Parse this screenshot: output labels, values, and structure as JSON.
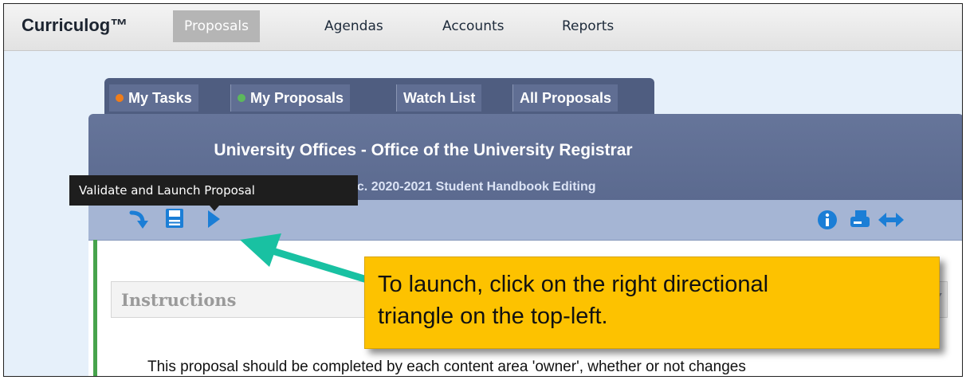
{
  "app": {
    "logo": "Curriculog™"
  },
  "nav": [
    {
      "label": "Proposals",
      "active": true
    },
    {
      "label": "Agendas",
      "active": false
    },
    {
      "label": "Accounts",
      "active": false
    },
    {
      "label": "Reports",
      "active": false
    }
  ],
  "tabs": [
    {
      "label": "My Tasks",
      "dot": "#f07d1a"
    },
    {
      "label": "My Proposals",
      "dot": "#5cb85c"
    },
    {
      "label": "Watch List",
      "dot": ""
    },
    {
      "label": "All Proposals",
      "dot": ""
    }
  ],
  "panel": {
    "title": "University Offices - Office of the University Registrar",
    "subtitle": "7c. 2020-2021 Student Handbook Editing"
  },
  "toolbar": {
    "left_icons": [
      "curved-arrow-icon",
      "save-icon",
      "play-triangle-icon"
    ],
    "right_icons": [
      "info-icon",
      "print-icon",
      "expand-horizontal-icon"
    ]
  },
  "tooltip": {
    "text": "Validate and Launch Proposal"
  },
  "instructions": {
    "label": "Instructions"
  },
  "body_text": "This proposal should be completed by each content area 'owner', whether or not changes",
  "callout": {
    "line1": "To launch, click on the right directional",
    "line2": "triangle on the top-left."
  },
  "colors": {
    "accent": "#1b7ed6",
    "callout_bg": "#fdc200",
    "arrow": "#19c1a2",
    "panel_header": "#5b6a8f"
  }
}
